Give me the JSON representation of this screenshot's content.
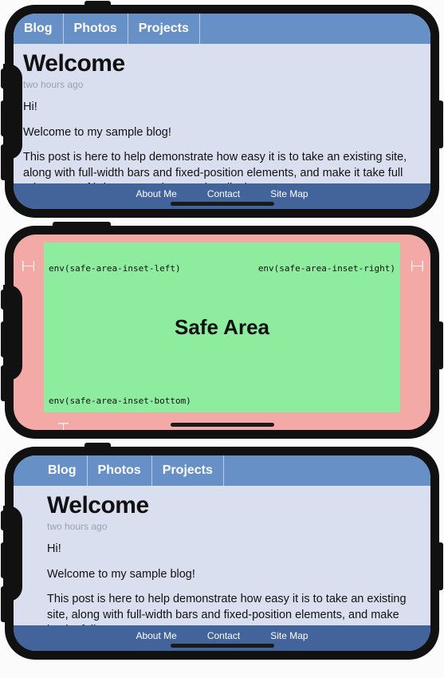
{
  "nav": {
    "tabs": [
      "Blog",
      "Photos",
      "Projects"
    ]
  },
  "post": {
    "title": "Welcome",
    "meta": "two hours ago",
    "p1": "Hi!",
    "p2": "Welcome to my sample blog!",
    "p3": "This post is here to help demonstrate how easy it is to take an existing site, along with full-width bars and fixed-position elements, and make it take full advantage of iPhone X's edge-to-edge display.",
    "p3_cut": "This post is here to help demonstrate how easy it is to take an existing site, along with full-width bars and fixed-position elements, and make it take full"
  },
  "footer": {
    "links": [
      "About Me",
      "Contact",
      "Site Map"
    ]
  },
  "safearea": {
    "title": "Safe Area",
    "left": "env(safe-area-inset-left)",
    "right": "env(safe-area-inset-right)",
    "bottom": "env(safe-area-inset-bottom)"
  }
}
